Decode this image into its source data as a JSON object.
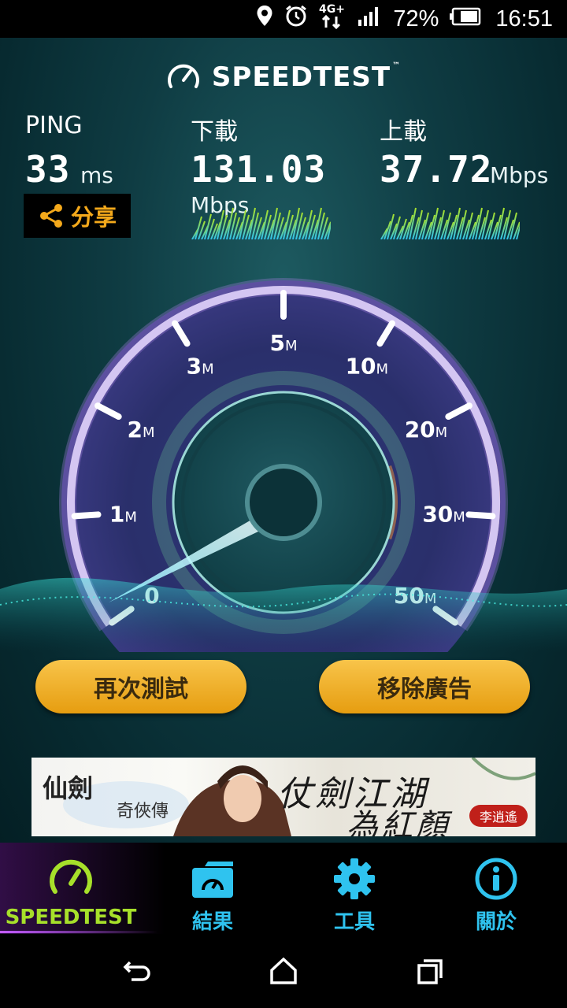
{
  "status_bar": {
    "network": "4G+",
    "battery": "72%",
    "time": "16:51",
    "icons": [
      "location-icon",
      "alarm-icon",
      "network-icon",
      "signal-icon",
      "battery-icon"
    ]
  },
  "header": {
    "logo_text": "SPEEDTEST",
    "trademark": "™"
  },
  "ping": {
    "label": "PING",
    "value": "33",
    "unit": "ms"
  },
  "download": {
    "label": "下載",
    "value": "131.03",
    "unit": "Mbps"
  },
  "upload": {
    "label": "上載",
    "value": "37.72",
    "unit": "Mbps"
  },
  "share": {
    "label": "分享"
  },
  "gauge": {
    "ticks": [
      {
        "num": "0",
        "unit": ""
      },
      {
        "num": "1",
        "unit": "M"
      },
      {
        "num": "2",
        "unit": "M"
      },
      {
        "num": "3",
        "unit": "M"
      },
      {
        "num": "5",
        "unit": "M"
      },
      {
        "num": "10",
        "unit": "M"
      },
      {
        "num": "20",
        "unit": "M"
      },
      {
        "num": "30",
        "unit": "M"
      },
      {
        "num": "50",
        "unit": "M"
      }
    ]
  },
  "buttons": {
    "retest": "再次測試",
    "remove_ads": "移除廣告"
  },
  "ad": {
    "game_title": "仙劍",
    "game_subtitle": "奇俠傳",
    "slogan_line1": "仗劍江湖",
    "slogan_line2": "為紅顏",
    "seal": "李逍遙"
  },
  "bottom_nav": {
    "items": [
      {
        "label": "SPEEDTEST",
        "icon": "speedometer-icon",
        "active": true
      },
      {
        "label": "結果",
        "icon": "results-folder-icon",
        "active": false
      },
      {
        "label": "工具",
        "icon": "gear-icon",
        "active": false
      },
      {
        "label": "關於",
        "icon": "info-icon",
        "active": false
      }
    ]
  },
  "colors": {
    "accent_orange": "#f4a91b",
    "nav_blue": "#2fc3ef",
    "active_green": "#a7e02a",
    "gauge_purple": "#9f7bd9",
    "gauge_orange": "#e08a3a"
  }
}
